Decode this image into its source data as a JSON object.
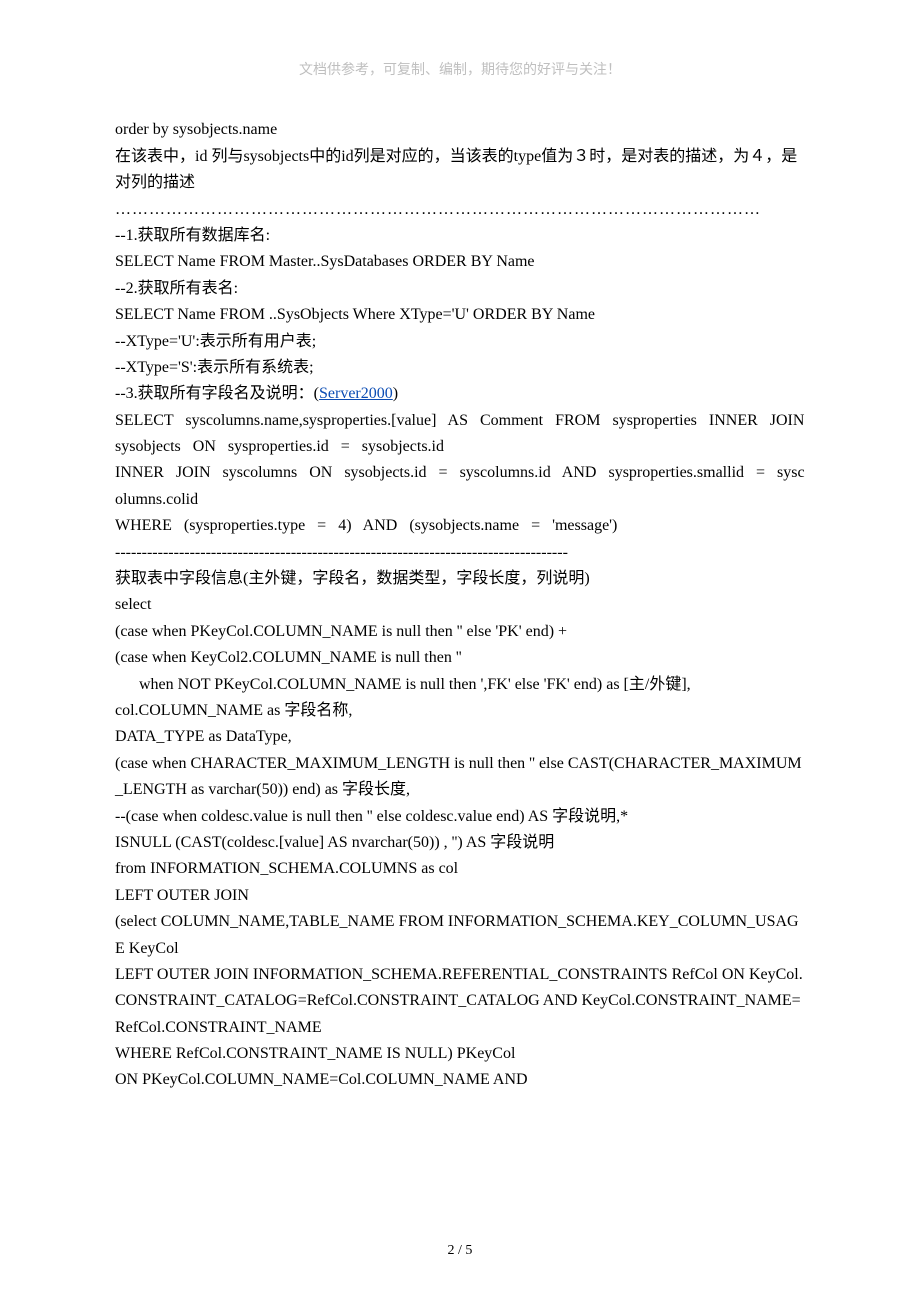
{
  "header_note": "文档供参考，可复制、编制，期待您的好评与关注！",
  "lines": [
    "order by sysobjects.name",
    "在该表中，id 列与sysobjects中的id列是对应的，当该表的type值为３时，是对表的描述，为４，是对列的描述",
    "",
    "……………………………………………………………………………………………………",
    "--1.获取所有数据库名:",
    "SELECT Name FROM Master..SysDatabases ORDER BY Name",
    "--2.获取所有表名:",
    "SELECT Name FROM ..SysObjects Where XType='U' ORDER BY Name",
    "--XType='U':表示所有用户表;",
    "--XType='S':表示所有系统表;"
  ],
  "line_with_link_prefix": "--3.获取所有字段名及说明：(",
  "link_text": "Server2000",
  "line_with_link_suffix": ")",
  "rest": [
    "SELECT   syscolumns.name,sysproperties.[value]   AS   Comment   FROM   sysproperties   INNER   JOIN   sysobjects   ON   sysproperties.id   =   sysobjects.id",
    "INNER   JOIN   syscolumns   ON   sysobjects.id   =   syscolumns.id   AND   sysproperties.smallid   =   syscolumns.colid",
    "WHERE   (sysproperties.type   =   4)   AND   (sysobjects.name   =   'message')",
    "-------------------------------------------------------------------------------------",
    "获取表中字段信息(主外键，字段名，数据类型，字段长度，列说明)",
    "select",
    "(case when PKeyCol.COLUMN_NAME is null then '' else 'PK' end) +",
    "(case when KeyCol2.COLUMN_NAME is null then ''",
    "      when NOT PKeyCol.COLUMN_NAME is null then ',FK' else 'FK' end) as [主/外键],",
    "col.COLUMN_NAME as 字段名称,",
    "DATA_TYPE as DataType,",
    "(case when CHARACTER_MAXIMUM_LENGTH is null then '' else CAST(CHARACTER_MAXIMUM_LENGTH as varchar(50)) end) as 字段长度,",
    "--(case when coldesc.value is null then '' else coldesc.value end) AS 字段说明,*",
    "ISNULL (CAST(coldesc.[value] AS nvarchar(50)) , '') AS 字段说明",
    "from INFORMATION_SCHEMA.COLUMNS as col",
    "LEFT OUTER JOIN",
    "(select COLUMN_NAME,TABLE_NAME FROM INFORMATION_SCHEMA.KEY_COLUMN_USAGE KeyCol",
    "LEFT OUTER JOIN INFORMATION_SCHEMA.REFERENTIAL_CONSTRAINTS RefCol ON KeyCol.CONSTRAINT_CATALOG=RefCol.CONSTRAINT_CATALOG AND KeyCol.CONSTRAINT_NAME=RefCol.CONSTRAINT_NAME",
    "WHERE RefCol.CONSTRAINT_NAME IS NULL) PKeyCol",
    "ON PKeyCol.COLUMN_NAME=Col.COLUMN_NAME AND"
  ],
  "footer": "2 / 5"
}
